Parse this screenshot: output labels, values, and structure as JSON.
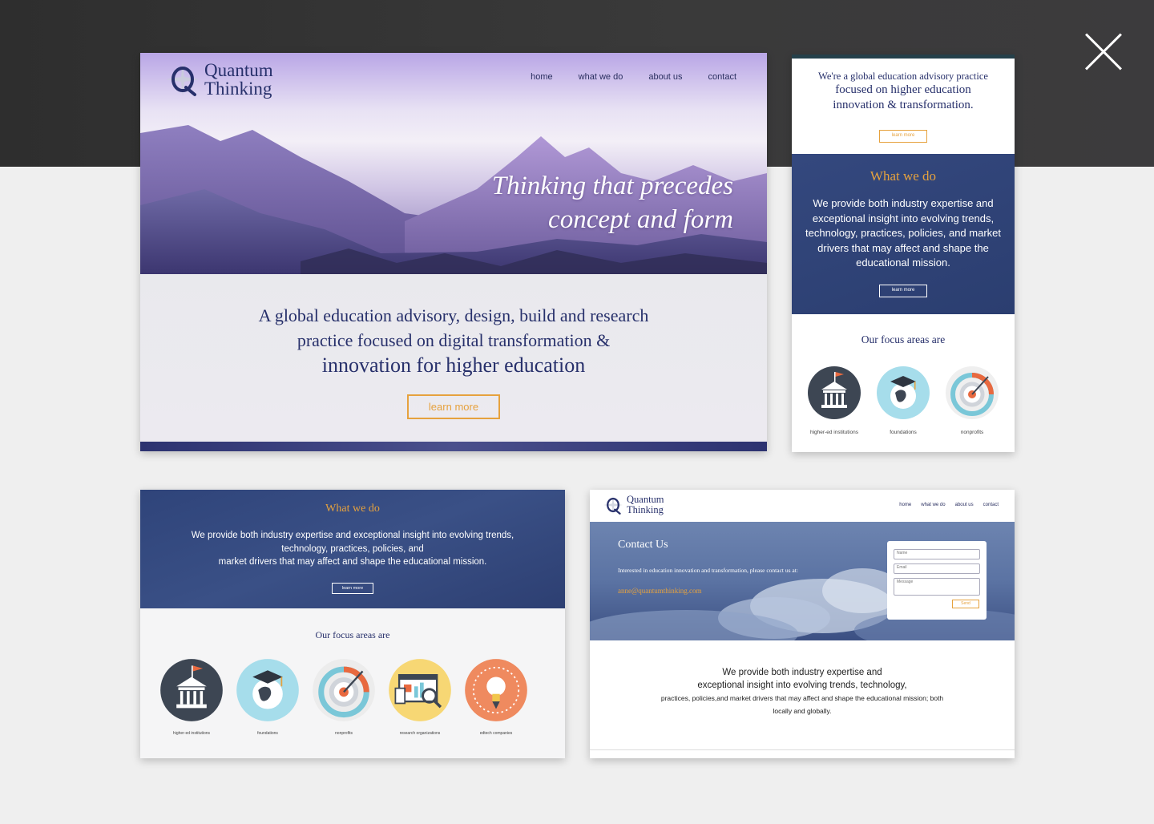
{
  "close_label": "",
  "brand": {
    "line1": "Quantum",
    "line2": "Thinking"
  },
  "nav": [
    "home",
    "what we do",
    "about us",
    "contact"
  ],
  "hero": {
    "tagline_l1": "Thinking that precedes",
    "tagline_l2": "concept and form",
    "headline_l1": "A global education advisory, design, build and research",
    "headline_l2": "practice focused on digital transformation &",
    "headline_l3": "innovation for higher education",
    "cta": "learn more"
  },
  "mobile": {
    "intro_l1": "We're a global education advisory practice",
    "intro_l2": "focused on higher education",
    "intro_l3": "innovation & transformation.",
    "intro_cta": "learn more",
    "what_title": "What we do",
    "what_desc": "We provide both industry expertise and exceptional insight into evolving trends, technology, practices, policies, and market drivers that may affect and shape the educational mission.",
    "what_cta": "learn more",
    "focus_title": "Our focus areas are",
    "focus": [
      "higher-ed institutions",
      "foundations",
      "nonprofits"
    ]
  },
  "what_card": {
    "title": "What we do",
    "desc_l1": "We provide both industry expertise and exceptional insight into evolving trends,",
    "desc_l2": "technology, practices, policies, and",
    "desc_l3": "market drivers that may affect and shape the educational mission.",
    "cta": "learn more",
    "focus_title": "Our focus areas are",
    "focus": [
      "higher-ed institutions",
      "foundations",
      "nonprofits",
      "research organizations",
      "edtech companies"
    ]
  },
  "contact_card": {
    "title": "Contact Us",
    "desc": "Interested in education innovation and transformation, please contact us at:",
    "email": "anne@quantumthinking.com",
    "name_ph": "Name",
    "email_ph": "Email",
    "message_ph": "Message",
    "send": "Send",
    "body_l1": "We provide both industry expertise and",
    "body_l2": "exceptional insight into evolving trends, technology,",
    "body_l3": "practices, policies,and market drivers that may affect and shape the educational mission; both",
    "body_l4": "locally and globally."
  },
  "colors": {
    "navy": "#27306b",
    "accent": "#e6a23e",
    "blue_panel": "#2f447a"
  },
  "icons": [
    "close-icon",
    "logo-q-icon",
    "university-icon",
    "graduation-globe-icon",
    "target-icon",
    "analytics-icon",
    "lightbulb-icon"
  ]
}
